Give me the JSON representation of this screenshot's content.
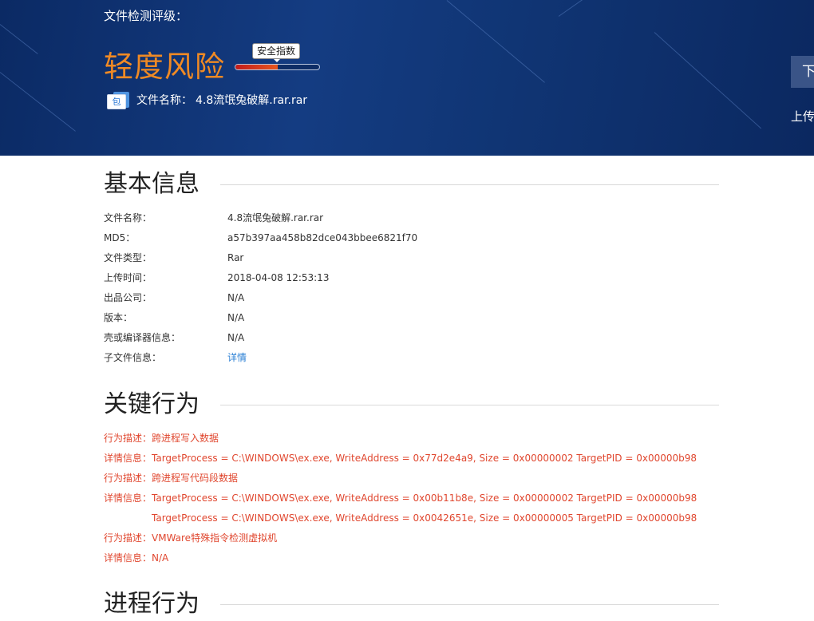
{
  "header": {
    "rating_title": "文件检测评级：",
    "risk_level": "轻度风险",
    "score_label": "安全指数",
    "score_fraction": 0.5,
    "file_label": "文件名称：",
    "file_name": "4.8流氓兔破解.rar.rar",
    "package_icon_char": "包",
    "right_button_label": "下",
    "right_upload_text": "上传"
  },
  "basic_info": {
    "title": "基本信息",
    "rows": [
      {
        "key": "文件名称：",
        "value": "4.8流氓兔破解.rar.rar"
      },
      {
        "key": "MD5：",
        "value": "a57b397aa458b82dce043bbee6821f70"
      },
      {
        "key": "文件类型：",
        "value": "Rar"
      },
      {
        "key": "上传时间：",
        "value": "2018-04-08 12:53:13"
      },
      {
        "key": "出品公司：",
        "value": "N/A"
      },
      {
        "key": "版本：",
        "value": "N/A"
      },
      {
        "key": "壳或编译器信息：",
        "value": "N/A"
      },
      {
        "key": "子文件信息：",
        "value": "详情"
      }
    ]
  },
  "key_behavior": {
    "title": "关键行为",
    "rows": [
      {
        "text": "行为描述：跨进程写入数据"
      },
      {
        "text": "详情信息：TargetProcess = C:\\WINDOWS\\ex.exe, WriteAddress = 0x77d2e4a9, Size = 0x00000002 TargetPID = 0x00000b98"
      },
      {
        "text": "行为描述：跨进程写代码段数据"
      },
      {
        "text": "详情信息：TargetProcess = C:\\WINDOWS\\ex.exe, WriteAddress = 0x00b11b8e, Size = 0x00000002 TargetPID = 0x00000b98"
      },
      {
        "text": "TargetProcess = C:\\WINDOWS\\ex.exe, WriteAddress = 0x0042651e, Size = 0x00000005 TargetPID = 0x00000b98"
      },
      {
        "text": "行为描述：VMWare特殊指令检测虚拟机"
      },
      {
        "text": "详情信息：N/A"
      }
    ]
  },
  "process_behavior": {
    "title": "进程行为"
  },
  "colors": {
    "banner": "#143c82",
    "risk_orange": "#f08a24",
    "behavior_red": "#e0472f",
    "link_blue": "#2a7fd4"
  }
}
